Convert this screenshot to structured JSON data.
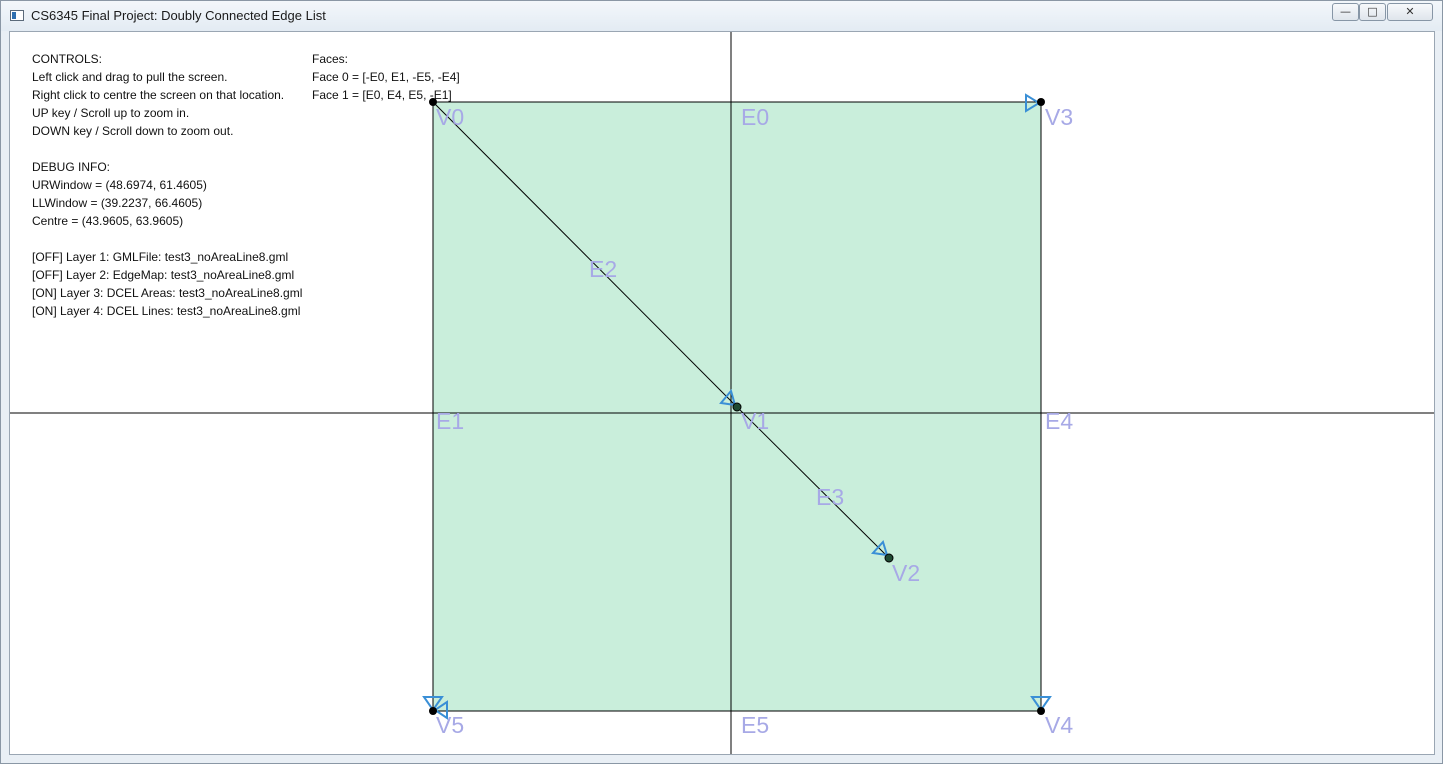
{
  "window": {
    "title": "CS6345 Final Project: Doubly Connected Edge List",
    "buttons": {
      "minimize": "—",
      "maximize": "□",
      "close": "✕"
    }
  },
  "controls": {
    "heading": "CONTROLS:",
    "lines": [
      "Left click and drag to pull the screen.",
      "Right click to centre the screen on that location.",
      "UP key / Scroll up to zoom in.",
      "DOWN key / Scroll down to zoom out."
    ]
  },
  "debug": {
    "heading": "DEBUG INFO:",
    "ur_window": "URWindow = (48.6974, 61.4605)",
    "ll_window": "LLWindow = (39.2237, 66.4605)",
    "centre": "Centre = (43.9605, 63.9605)"
  },
  "layers": [
    "[OFF] Layer 1: GMLFile: test3_noAreaLine8.gml",
    "[OFF] Layer 2: EdgeMap: test3_noAreaLine8.gml",
    "[ON] Layer 3: DCEL Areas: test3_noAreaLine8.gml",
    "[ON] Layer 4: DCEL Lines: test3_noAreaLine8.gml"
  ],
  "faces": {
    "heading": "Faces:",
    "lines": [
      "Face 0 = [-E0, E1, -E5, -E4]",
      "Face 1 = [E0, E4, E5, -E1]"
    ]
  },
  "vertex_labels": [
    "V0",
    "V1",
    "V2",
    "V3",
    "V4",
    "V5"
  ],
  "edge_labels": [
    "E0",
    "E1",
    "E2",
    "E3",
    "E4",
    "E5"
  ],
  "colors": {
    "face_fill": "#c9eedb",
    "label": "#a7a9e6",
    "arrow": "#3a8fd6",
    "vertex_outer": "#000000",
    "vertex_inner": "#1f4a32"
  }
}
